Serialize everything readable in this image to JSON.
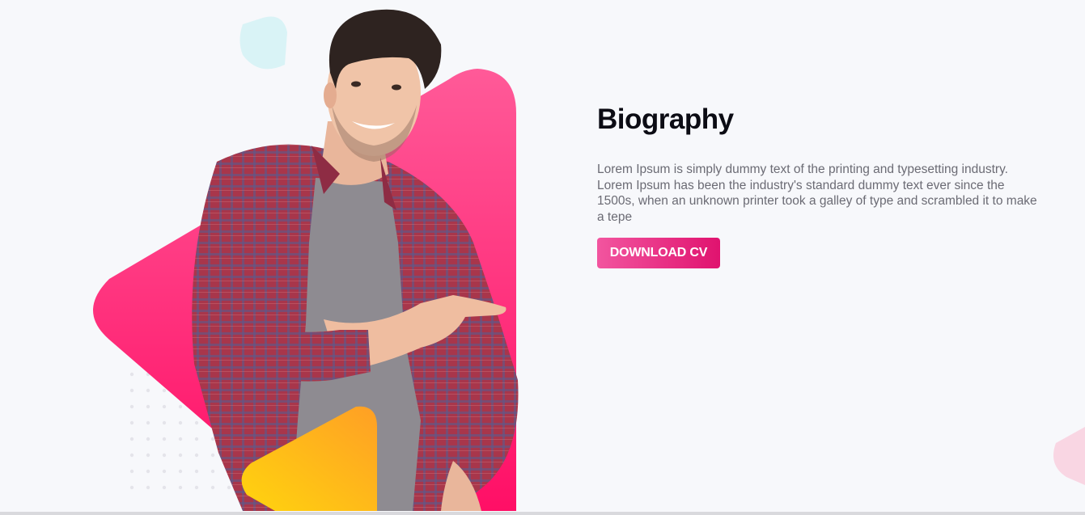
{
  "biography": {
    "title": "Biography",
    "text": "Lorem Ipsum is simply dummy text of the printing and typesetting industry. Lorem Ipsum has been the industry's standard dummy text ever since the 1500s, when an unknown printer took a galley of type and scrambled it to make a tepe",
    "button_label": "DOWNLOAD CV"
  },
  "colors": {
    "accent_pink": "#ff2e7e",
    "accent_yellow": "#ffc21a",
    "accent_cyan": "#d7f3f6",
    "background": "#f7f8fb"
  },
  "hero_image": {
    "description_icon": "person-pointing-icon"
  }
}
